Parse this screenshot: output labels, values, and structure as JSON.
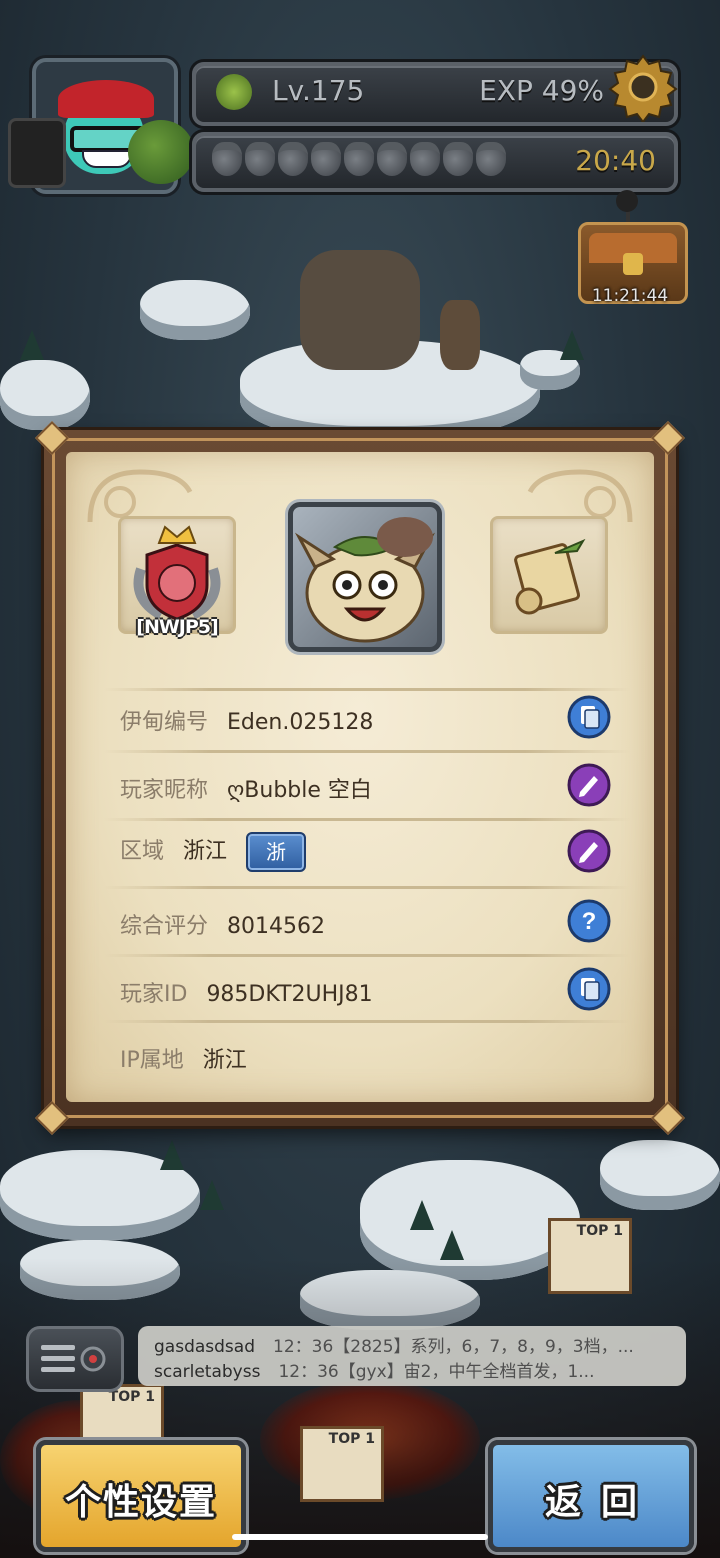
{
  "hud": {
    "level": "Lv.175",
    "exp": "EXP 49%",
    "time": "20:40",
    "acorn_count": 9
  },
  "chest": {
    "timer": "11:21:44"
  },
  "profile": {
    "badge_label": "[NWJP5]",
    "rows": [
      {
        "label": "伊甸编号",
        "value": "Eden.025128",
        "action": "copy-icon"
      },
      {
        "label": "玩家昵称",
        "value": "ღBubble 空白",
        "action": "edit-icon"
      },
      {
        "label": "区域",
        "value": "浙江",
        "tag": "浙",
        "action": "edit-icon"
      },
      {
        "label": "综合评分",
        "value": "8014562",
        "action": "help-icon"
      },
      {
        "label": "玩家ID",
        "value": "985DKT2UHJ81",
        "action": "copy-icon"
      },
      {
        "label": "IP属地",
        "value": "浙江"
      }
    ]
  },
  "chat": {
    "lines": [
      {
        "user": "gasdasdsad",
        "message": "12：36【2825】系列，6，7，8，9，3档，..."
      },
      {
        "user": "scarletabyss",
        "message": "12：36【gyx】宙2，中午全档首发，1..."
      }
    ]
  },
  "buttons": {
    "settings": "个性设置",
    "back": "返回"
  },
  "map_labels": {
    "top1": "TOP 1"
  },
  "colors": {
    "copy": "#3f7fd6",
    "edit": "#8a3fb8",
    "help": "#3f7fd6",
    "settings_button": "#f0c050",
    "back_button": "#6aa8dd"
  }
}
